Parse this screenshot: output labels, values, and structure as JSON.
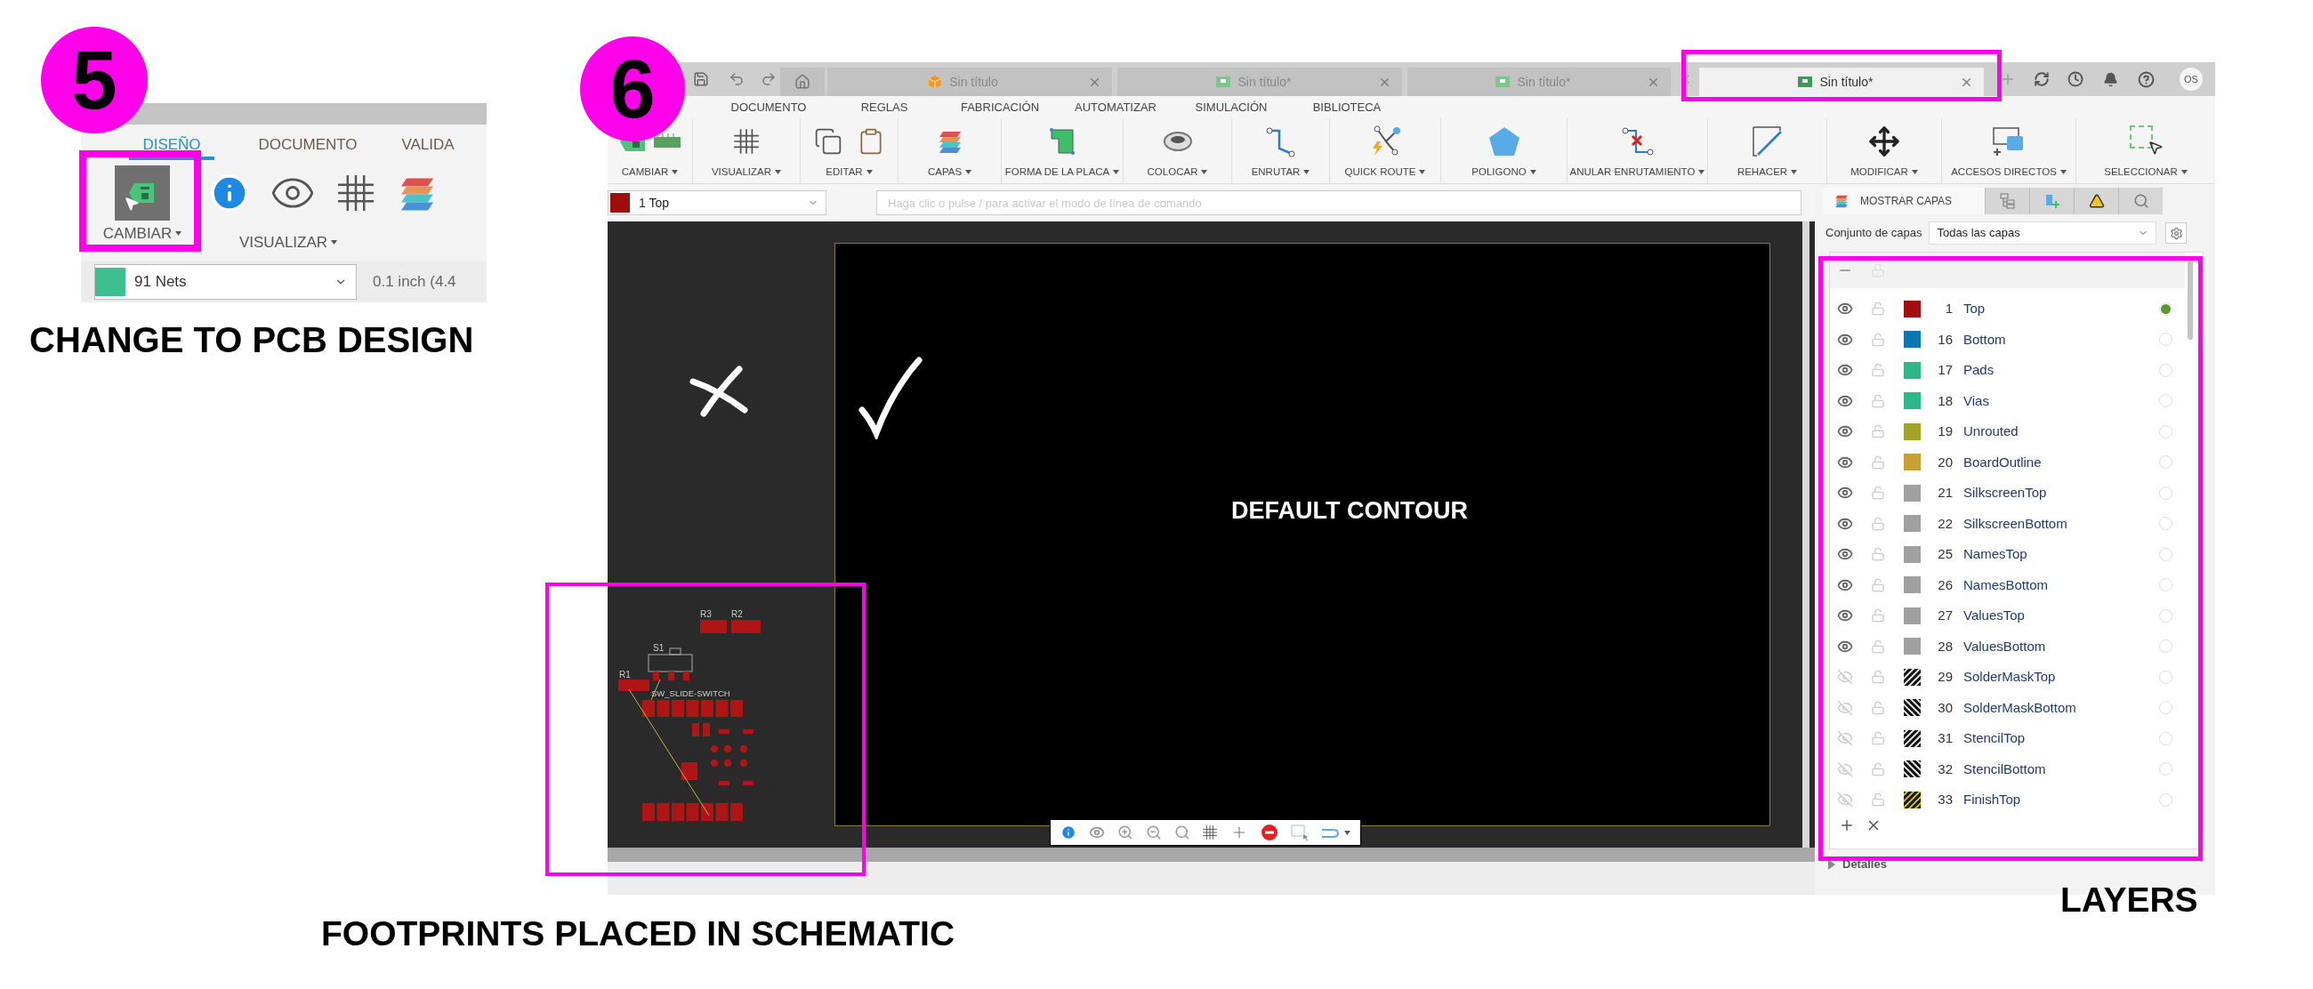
{
  "step5": {
    "badge": "5",
    "tabs": [
      {
        "label": "DISEÑO",
        "selected": true
      },
      {
        "label": "DOCUMENTO",
        "selected": false
      },
      {
        "label": "VALIDA",
        "selected": false
      }
    ],
    "groups": [
      "CAMBIAR",
      "VISUALIZAR"
    ],
    "nets": {
      "value": "91 Nets",
      "color": "#3dbf8f"
    },
    "grid": "0.1 inch (4.4",
    "caption": "CHANGE TO PCB DESIGN"
  },
  "step6": {
    "badge": "6",
    "tabs": [
      {
        "label": "Sin título",
        "kind": "design",
        "selected": false
      },
      {
        "label": "Sin título*",
        "kind": "electronics",
        "selected": false
      },
      {
        "label": "Sin título*",
        "kind": "electronics",
        "selected": false
      },
      {
        "label": "Sin título*",
        "kind": "electronics",
        "selected": true
      }
    ],
    "user": "OS",
    "menu": [
      "DOCUMENTO",
      "REGLAS",
      "FABRICACIÓN",
      "AUTOMATIZAR",
      "SIMULACIÓN",
      "BIBLIOTECA"
    ],
    "toolbar": [
      "CAMBIAR",
      "VISUALIZAR",
      "EDITAR",
      "CAPAS",
      "FORMA DE LA PLACA",
      "COLOCAR",
      "ENRUTAR",
      "QUICK ROUTE",
      "POLIGONO",
      "ANULAR ENRUTAMIENTO",
      "REHACER",
      "MODIFICAR",
      "ACCESOS DIRECTOS",
      "SELECCIONAR"
    ],
    "layer_select": {
      "value": "1 Top",
      "color": "#a00d0d"
    },
    "command_placeholder": "Haga clic o pulse / para activar el modo de línea de comando",
    "panel": {
      "tab": "MOSTRAR CAPAS",
      "layer_set_label": "Conjunto de capas",
      "layer_set_value": "Todas las capas",
      "details": "Detalles",
      "layers": [
        {
          "number": "1",
          "name": "Top",
          "color": "#a30f0f",
          "kind": "solid",
          "visible": true,
          "selected": true
        },
        {
          "number": "16",
          "name": "Bottom",
          "color": "#0a78b4",
          "kind": "solid",
          "visible": true,
          "selected": false
        },
        {
          "number": "17",
          "name": "Pads",
          "color": "#2eb88a",
          "kind": "solid",
          "visible": true,
          "selected": false
        },
        {
          "number": "18",
          "name": "Vias",
          "color": "#2eb88a",
          "kind": "solid",
          "visible": true,
          "selected": false
        },
        {
          "number": "19",
          "name": "Unrouted",
          "color": "#a3a327",
          "kind": "solid",
          "visible": true,
          "selected": false
        },
        {
          "number": "20",
          "name": "BoardOutline",
          "color": "#c9a035",
          "kind": "solid",
          "visible": true,
          "selected": false
        },
        {
          "number": "21",
          "name": "SilkscreenTop",
          "color": "#a0a0a0",
          "kind": "solid",
          "visible": true,
          "selected": false
        },
        {
          "number": "22",
          "name": "SilkscreenBottom",
          "color": "#a0a0a0",
          "kind": "solid",
          "visible": true,
          "selected": false
        },
        {
          "number": "25",
          "name": "NamesTop",
          "color": "#a0a0a0",
          "kind": "solid",
          "visible": true,
          "selected": false
        },
        {
          "number": "26",
          "name": "NamesBottom",
          "color": "#a0a0a0",
          "kind": "solid",
          "visible": true,
          "selected": false
        },
        {
          "number": "27",
          "name": "ValuesTop",
          "color": "#a0a0a0",
          "kind": "solid",
          "visible": true,
          "selected": false
        },
        {
          "number": "28",
          "name": "ValuesBottom",
          "color": "#a0a0a0",
          "kind": "solid",
          "visible": true,
          "selected": false
        },
        {
          "number": "29",
          "name": "SolderMaskTop",
          "color": "#d0d0d0",
          "kind": "hatched",
          "visible": false,
          "selected": false
        },
        {
          "number": "30",
          "name": "SolderMaskBottom",
          "color": "#d0d0d0",
          "kind": "hatched",
          "visible": false,
          "selected": false
        },
        {
          "number": "31",
          "name": "StencilTop",
          "color": "#d0d0d0",
          "kind": "hatched",
          "visible": false,
          "selected": false
        },
        {
          "number": "32",
          "name": "StencilBottom",
          "color": "#d0d0d0",
          "kind": "hatched",
          "visible": false,
          "selected": false
        },
        {
          "number": "33",
          "name": "FinishTop",
          "color": "#c8b000",
          "kind": "hatched",
          "visible": false,
          "selected": false
        }
      ]
    },
    "board_label": "DEFAULT CONTOUR",
    "footprint_labels": [
      "R3",
      "R2",
      "S1",
      "R1",
      "SW_SLIDE-SWITCH"
    ]
  },
  "captions": [
    "FOOTPRINTS PLACED IN SCHEMATIC",
    "LAYERS"
  ]
}
